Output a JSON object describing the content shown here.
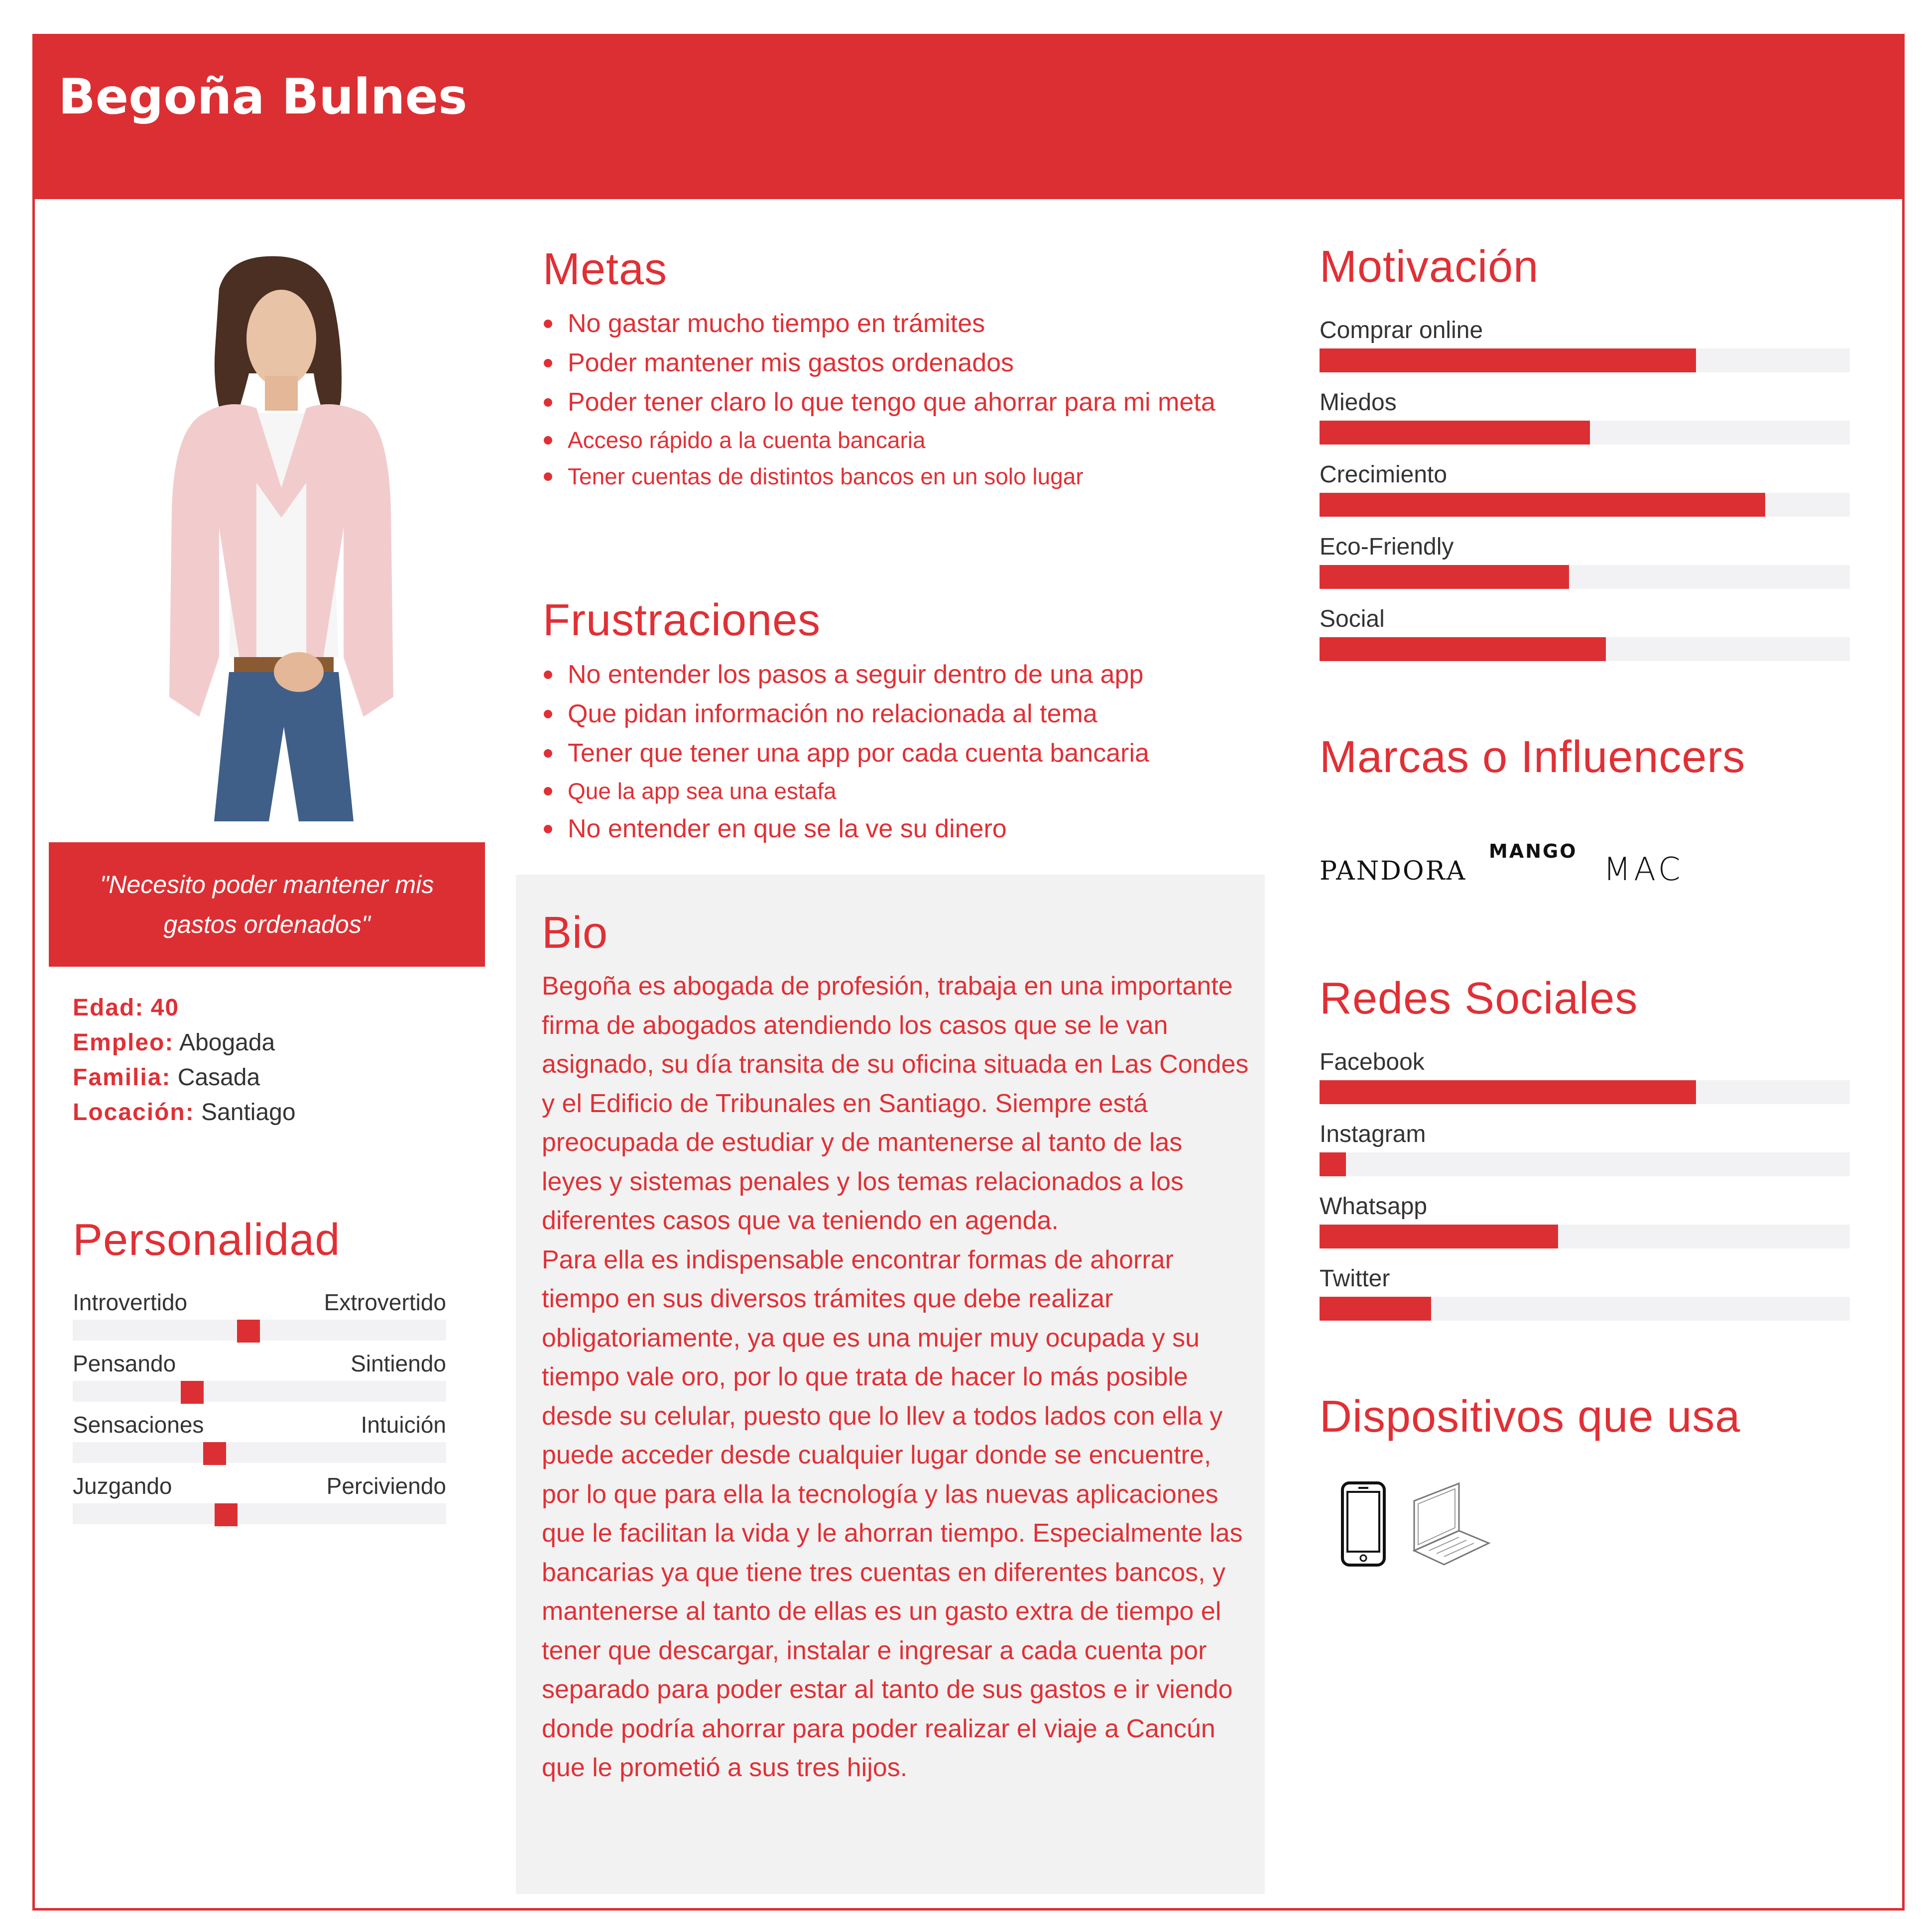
{
  "header": {
    "title": "Begoña Bulnes"
  },
  "quote": "\"Necesito poder mantener mis gastos ordenados\"",
  "facts": [
    {
      "label": "Edad:",
      "value": "40"
    },
    {
      "label": "Empleo:",
      "value": "Abogada"
    },
    {
      "label": "Familia:",
      "value": "Casada"
    },
    {
      "label": "Locación:",
      "value": "Santiago"
    }
  ],
  "personality": {
    "title": "Personalidad",
    "traits": [
      {
        "left": "Introvertido",
        "right": "Extrovertido",
        "level": 0.47
      },
      {
        "left": "Pensando",
        "right": "Sintiendo",
        "level": 0.32
      },
      {
        "left": "Sensaciones",
        "right": "Intuición",
        "level": 0.38
      },
      {
        "left": "Juzgando",
        "right": "Perciviendo",
        "level": 0.41
      }
    ]
  },
  "goals": {
    "title": "Metas",
    "items": [
      {
        "text": "No gastar mucho tiempo en trámites",
        "size": "big"
      },
      {
        "text": "Poder mantener mis gastos ordenados",
        "size": "big"
      },
      {
        "text": "Poder tener claro lo que tengo que ahorrar para mi meta",
        "size": "big"
      },
      {
        "text": "Acceso rápido a la cuenta bancaria",
        "size": "small"
      },
      {
        "text": "Tener cuentas de distintos bancos en un solo lugar",
        "size": "small"
      }
    ]
  },
  "frustrations": {
    "title": "Frustraciones",
    "items": [
      {
        "text": "No entender los pasos a seguir dentro de una app",
        "size": "big"
      },
      {
        "text": "Que pidan información no relacionada al tema",
        "size": "big"
      },
      {
        "text": "Tener que tener una app por cada cuenta bancaria",
        "size": "big"
      },
      {
        "text": "Que la app sea una estafa",
        "size": "small"
      },
      {
        "text": "No entender en que se la ve su dinero",
        "size": "big"
      }
    ]
  },
  "bio": {
    "title": "Bio",
    "paragraphs": [
      "Begoña es abogada de profesión, trabaja en una importante firma de abogados atendiendo los casos que se le van asignado, su día transita de su oficina situada en Las Condes y el Edificio de Tribunales en Santiago. Siempre está preocupada de estudiar y de mantenerse al tanto de las leyes y sistemas penales y los temas relacionados a los diferentes casos que va teniendo en agenda.",
      "Para ella es indispensable encontrar formas de ahorrar tiempo en sus diversos trámites que debe realizar obligatoriamente, ya que es una mujer muy ocupada y su tiempo vale oro, por lo que trata de hacer lo más posible desde su celular, puesto que lo llev a todos lados con ella y puede acceder desde cualquier lugar donde se encuentre, por lo que para ella la tecnología y las nuevas aplicaciones que le facilitan la vida y le ahorran tiempo. Especialmente las bancarias ya que tiene tres cuentas en diferentes bancos, y mantenerse al tanto de ellas es un gasto extra de tiempo el tener que descargar, instalar e ingresar a cada cuenta por separado para poder estar al tanto de sus gastos e ir viendo donde podría ahorrar para poder realizar el viaje a Cancún que le prometió a sus tres hijos."
    ]
  },
  "motivation": {
    "title": "Motivación",
    "bars": [
      {
        "label": "Comprar online",
        "value": 0.71
      },
      {
        "label": "Miedos",
        "value": 0.51
      },
      {
        "label": "Crecimiento",
        "value": 0.84
      },
      {
        "label": "Eco-Friendly",
        "value": 0.47
      },
      {
        "label": "Social",
        "value": 0.54
      }
    ]
  },
  "brands": {
    "title": "Marcas o Influencers",
    "logos": [
      "PANDORA",
      "MANGO",
      "MAC"
    ]
  },
  "social": {
    "title": "Redes Sociales",
    "bars": [
      {
        "label": "Facebook",
        "value": 0.71
      },
      {
        "label": "Instagram",
        "value": 0.05
      },
      {
        "label": "Whatsapp",
        "value": 0.45
      },
      {
        "label": "Twitter",
        "value": 0.21
      }
    ]
  },
  "devices": {
    "title": "Dispositivos que usa",
    "icons": [
      "smartphone-icon",
      "laptop-icon"
    ]
  },
  "colors": {
    "accent": "#dc2f33",
    "track": "#f2f2f4",
    "bio_bg": "#f2f2f2",
    "text_dark": "#333333"
  }
}
